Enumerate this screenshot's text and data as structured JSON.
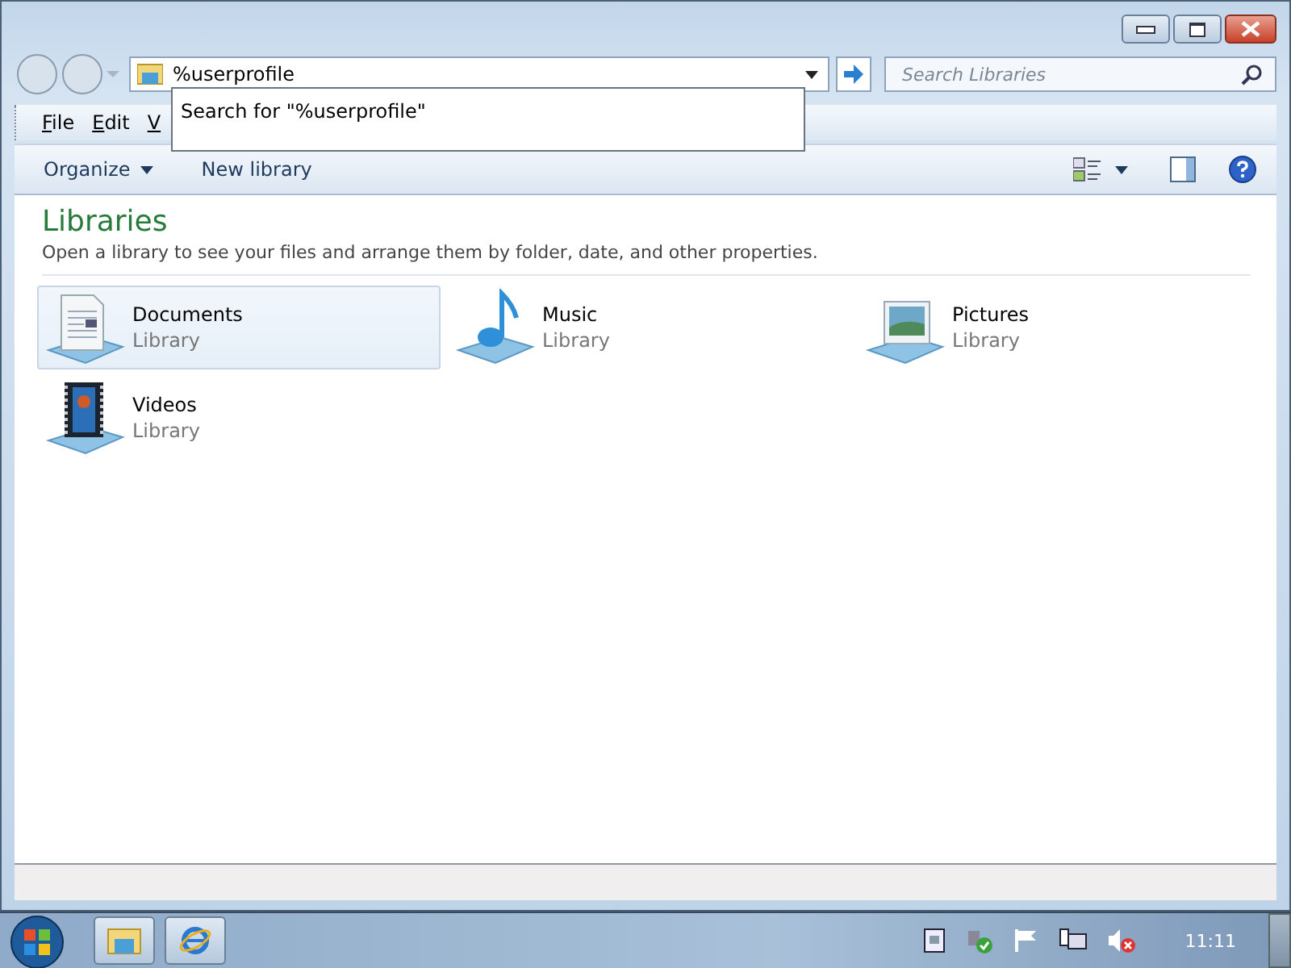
{
  "address_bar": {
    "value": "%userprofile"
  },
  "address_dropdown": {
    "suggestion": "Search for \"%userprofile\""
  },
  "search": {
    "placeholder": "Search Libraries"
  },
  "menu_bar": [
    "File",
    "Edit",
    "V"
  ],
  "command_bar": {
    "organize": "Organize",
    "new_library": "New library"
  },
  "content": {
    "title": "Libraries",
    "description": "Open a library to see your files and arrange them by folder, date, and other properties.",
    "items": [
      {
        "kind": "documents",
        "name": "Documents",
        "type": "Library",
        "selected": true
      },
      {
        "kind": "music",
        "name": "Music",
        "type": "Library",
        "selected": false
      },
      {
        "kind": "pictures",
        "name": "Pictures",
        "type": "Library",
        "selected": false
      },
      {
        "kind": "videos",
        "name": "Videos",
        "type": "Library",
        "selected": false
      }
    ]
  },
  "taskbar": {
    "clock": "11:11"
  }
}
